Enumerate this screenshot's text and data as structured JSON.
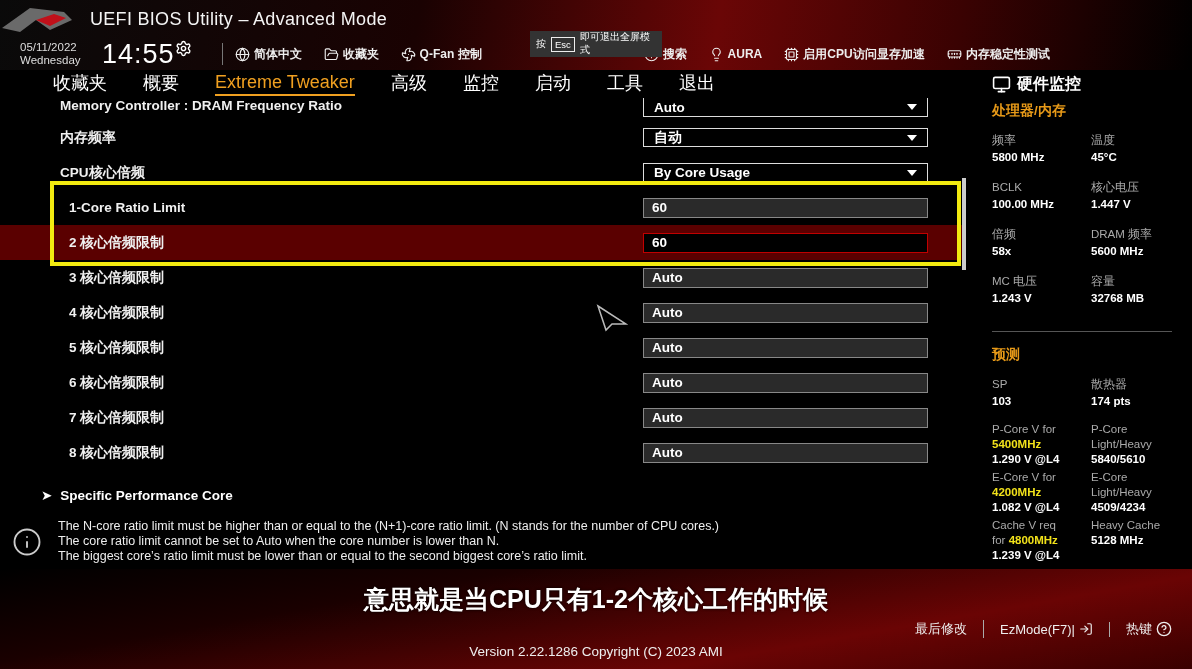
{
  "header": {
    "title": "UEFI BIOS Utility – Advanced Mode",
    "date": "05/11/2022",
    "weekday": "Wednesday",
    "time": "14:55",
    "toolbar": [
      {
        "label": "简体中文"
      },
      {
        "label": "收藏夹"
      },
      {
        "label": "Q-Fan 控制"
      },
      {
        "label": "搜索"
      },
      {
        "label": "AURA"
      },
      {
        "label": "启用CPU访问显存加速"
      },
      {
        "label": "内存稳定性测试"
      }
    ],
    "esc_hint": {
      "before": "按",
      "key": "Esc",
      "after": "即可退出全屏模式"
    }
  },
  "tabs": [
    {
      "label": "收藏夹",
      "selected": false
    },
    {
      "label": "概要",
      "selected": false
    },
    {
      "label": "Extreme Tweaker",
      "selected": true
    },
    {
      "label": "高级",
      "selected": false
    },
    {
      "label": "监控",
      "selected": false
    },
    {
      "label": "启动",
      "selected": false
    },
    {
      "label": "工具",
      "selected": false
    },
    {
      "label": "退出",
      "selected": false
    }
  ],
  "settings": [
    {
      "label": "Memory Controller : DRAM Frequency Ratio",
      "value": "Auto",
      "kind": "dropdown",
      "selected": false
    },
    {
      "label": "内存频率",
      "value": "自动",
      "kind": "dropdown",
      "selected": false
    },
    {
      "label": "CPU核心倍频",
      "value": "By Core Usage",
      "kind": "dropdown",
      "selected": false
    },
    {
      "label": "1-Core Ratio Limit",
      "value": "60",
      "kind": "field",
      "selected": false
    },
    {
      "label": "2 核心倍频限制",
      "value": "60",
      "kind": "field",
      "selected": true
    },
    {
      "label": "3 核心倍频限制",
      "value": "Auto",
      "kind": "field",
      "selected": false
    },
    {
      "label": "4 核心倍频限制",
      "value": "Auto",
      "kind": "field",
      "selected": false
    },
    {
      "label": "5 核心倍频限制",
      "value": "Auto",
      "kind": "field",
      "selected": false
    },
    {
      "label": "6 核心倍频限制",
      "value": "Auto",
      "kind": "field",
      "selected": false
    },
    {
      "label": "7 核心倍频限制",
      "value": "Auto",
      "kind": "field",
      "selected": false
    },
    {
      "label": "8 核心倍频限制",
      "value": "Auto",
      "kind": "field",
      "selected": false
    }
  ],
  "submenu": {
    "arrow": "➤",
    "label": "Specific Performance Core"
  },
  "info": [
    "The N-core ratio limit must be higher than or equal to the (N+1)-core ratio limit. (N stands for the number of CPU cores.)",
    "The core ratio limit cannot be set to Auto when the core number is lower than N.",
    "The biggest core’s ratio limit must be lower than or equal to the second biggest core’s ratio limit."
  ],
  "monitor": {
    "title": "硬件监控",
    "cpu_memory": {
      "title": "处理器/内存",
      "items": [
        {
          "label": "频率",
          "value": "5800 MHz"
        },
        {
          "label": "温度",
          "value": "45°C"
        },
        {
          "label": "BCLK",
          "value": "100.00 MHz"
        },
        {
          "label": "核心电压",
          "value": "1.447 V"
        },
        {
          "label": "倍频",
          "value": "58x"
        },
        {
          "label": "DRAM 频率",
          "value": "5600 MHz"
        },
        {
          "label": "MC 电压",
          "value": "1.243 V"
        },
        {
          "label": "容量",
          "value": "32768 MB"
        }
      ]
    },
    "prediction": {
      "title": "预测",
      "items": [
        {
          "label": "SP",
          "value": "103"
        },
        {
          "label": "散热器",
          "value": "174 pts"
        }
      ],
      "voltages": [
        {
          "label": "P-Core V for",
          "freq": "5400MHz",
          "value": "1.290 V @L4",
          "right_label": "P-Core Light/Heavy",
          "right_value": "5840/5610"
        },
        {
          "label": "E-Core V for",
          "freq": "4200MHz",
          "value": "1.082 V @L4",
          "right_label": "E-Core Light/Heavy",
          "right_value": "4509/4234"
        },
        {
          "label": "Cache V req",
          "prefix": "for",
          "freq": "4800MHz",
          "value": "1.239 V @L4",
          "right_label": "Heavy Cache",
          "right_value": "5128 MHz"
        }
      ]
    }
  },
  "subtitle": "意思就是当CPU只有1-2个核心工作的时候",
  "footer": {
    "buttons": [
      {
        "label": "最后修改"
      },
      {
        "label": "EzMode(F7)|"
      },
      {
        "label": "热键"
      }
    ],
    "version": "Version 2.22.1286 Copyright (C) 2023 AMI"
  }
}
